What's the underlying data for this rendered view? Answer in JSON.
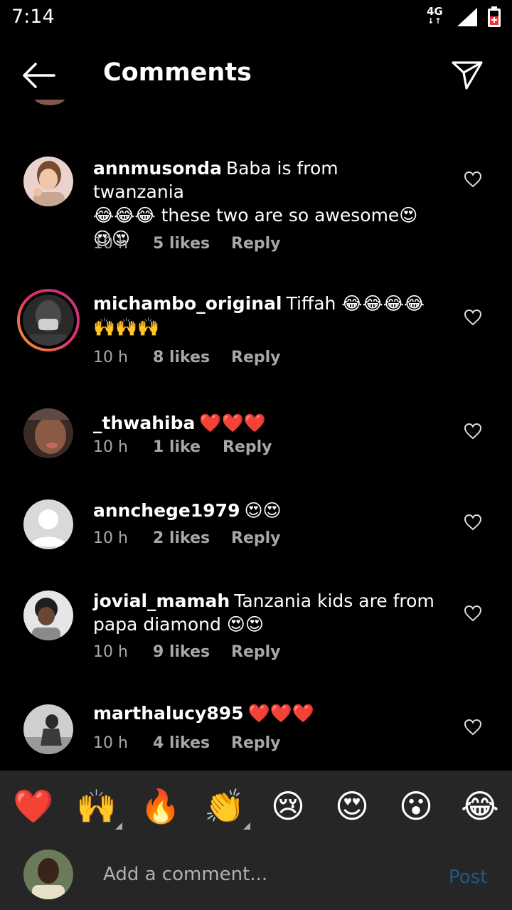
{
  "status": {
    "time": "7:14",
    "network": "4G",
    "network_arrows": "↓↑"
  },
  "header": {
    "title": "Comments",
    "back_icon": "arrow-left-icon",
    "share_icon": "send-icon"
  },
  "comments": [
    {
      "user": "annmusonda",
      "line1": "Baba is from twanzania",
      "line2": "😂😂😂 these two are so awesome😍",
      "line3": "😍😍",
      "time": "10 h",
      "likes": "5 likes",
      "reply": "Reply"
    },
    {
      "user": "michambo_original",
      "line1": "Tiffah 😂😂😂😂",
      "line2": "🙌🙌🙌",
      "time": "10 h",
      "likes": "8 likes",
      "reply": "Reply",
      "story_ring": true
    },
    {
      "user": "_thwahiba",
      "line1": "❤️❤️❤️",
      "time": "10 h",
      "likes": "1 like",
      "reply": "Reply"
    },
    {
      "user": "annchege1979",
      "line1": "😍😍",
      "time": "10 h",
      "likes": "2 likes",
      "reply": "Reply"
    },
    {
      "user": "jovial_mamah",
      "line1": "Tanzania kids are from",
      "line2": "papa diamond 😍😍",
      "time": "10 h",
      "likes": "9 likes",
      "reply": "Reply"
    },
    {
      "user": "marthalucy895",
      "line1": "❤️❤️❤️",
      "time": "10 h",
      "likes": "4 likes",
      "reply": "Reply"
    }
  ],
  "emoji_bar": [
    "❤️",
    "🙌",
    "🔥",
    "👏",
    "😢",
    "😍",
    "😮",
    "😂"
  ],
  "composer": {
    "placeholder": "Add a comment...",
    "post_label": "Post"
  }
}
